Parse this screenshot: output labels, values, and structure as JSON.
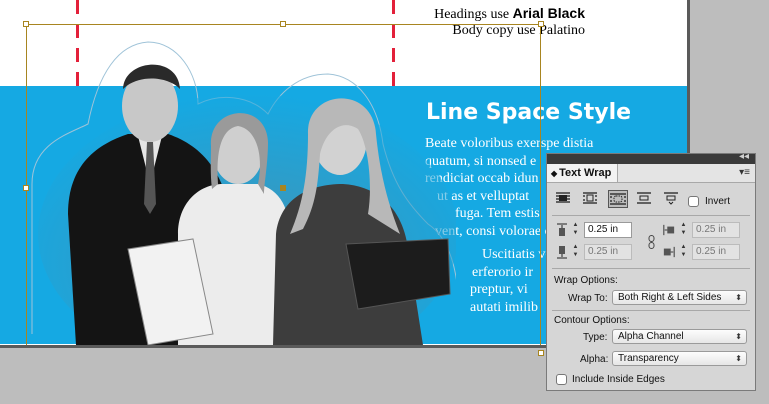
{
  "notes": {
    "headings_prefix": "Headings use",
    "headings_font": "Arial Black",
    "body_line": "Body copy use Palatino"
  },
  "article": {
    "heading": "Line Space Style",
    "lines_top": [
      "Beate voloribus exerspe distia",
      "quatum, si nonsed e",
      "rendiciat occab idun",
      "ut as et velluptat",
      "fuga. Tem estis",
      "vent, consi volorae c"
    ],
    "lines_bottom": [
      "Uscitiatis vo",
      "erferorio ir",
      "preptur, vi",
      "autati imilib"
    ]
  },
  "panel": {
    "collapse_glyph": "◂◂",
    "tab_label": "Text Wrap",
    "tab_glyph": "◆",
    "menu_glyph": "▾≡",
    "invert_label": "Invert",
    "active_wrap_index": 2,
    "offsets": {
      "top": "0.25 in",
      "bottom": "0.25 in",
      "left": "0.25 in",
      "right": "0.25 in"
    },
    "wrap_options_label": "Wrap Options:",
    "wrap_to_label": "Wrap To:",
    "wrap_to_value": "Both Right & Left Sides",
    "contour_options_label": "Contour Options:",
    "type_label": "Type:",
    "type_value": "Alpha Channel",
    "alpha_label": "Alpha:",
    "alpha_value": "Transparency",
    "include_inside_label": "Include Inside Edges"
  },
  "colors": {
    "band": "#15a9e3",
    "guide": "#e3203a",
    "frame": "#a88520"
  },
  "icons": [
    "double-chevron-left-icon",
    "panel-menu-icon",
    "no-wrap-icon",
    "wrap-bounding-box-icon",
    "wrap-object-shape-icon",
    "jump-object-icon",
    "jump-to-next-column-icon",
    "top-offset-icon",
    "bottom-offset-icon",
    "left-offset-icon",
    "right-offset-icon",
    "chain-link-icon"
  ]
}
